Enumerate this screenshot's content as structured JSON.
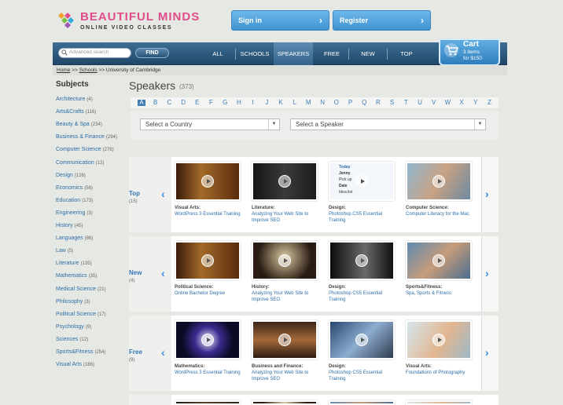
{
  "header": {
    "logo_title": "BEAUTIFUL MINDS",
    "logo_subtitle": "ONLINE VIDEO CLASSES",
    "signin_label": "Sign in",
    "register_label": "Register"
  },
  "search": {
    "placeholder": "Advanced search",
    "find_label": "FIND"
  },
  "nav": {
    "items": [
      "ALL",
      "SCHOOLS",
      "SPEAKERS",
      "FREE",
      "NEW",
      "TOP"
    ],
    "active": "SPEAKERS"
  },
  "cart": {
    "title": "Cart",
    "items": "3 items",
    "total": "for $150"
  },
  "breadcrumb": {
    "home": "Home",
    "sep1": ">>",
    "schools": "Schools",
    "sep2": ">>",
    "current": "University of Cambridge"
  },
  "sidebar": {
    "title": "Subjects",
    "items": [
      {
        "label": "Architecture",
        "count": "(4)"
      },
      {
        "label": "Arts&Crafts",
        "count": "(116)"
      },
      {
        "label": "Beauty & Spa",
        "count": "(234)"
      },
      {
        "label": "Business & Finance",
        "count": "(294)"
      },
      {
        "label": "Computer Science",
        "count": "(276)"
      },
      {
        "label": "Communication",
        "count": "(12)"
      },
      {
        "label": "Design",
        "count": "(126)"
      },
      {
        "label": "Economics",
        "count": "(56)"
      },
      {
        "label": "Education",
        "count": "(173)"
      },
      {
        "label": "Engineering",
        "count": "(3)"
      },
      {
        "label": "History",
        "count": "(45)"
      },
      {
        "label": "Languages",
        "count": "(86)"
      },
      {
        "label": "Law",
        "count": "(5)"
      },
      {
        "label": "Literature",
        "count": "(135)"
      },
      {
        "label": "Mathematics",
        "count": "(35)"
      },
      {
        "label": "Medical Science",
        "count": "(21)"
      },
      {
        "label": "Philosophy",
        "count": "(3)"
      },
      {
        "label": "Political Science",
        "count": "(17)"
      },
      {
        "label": "Psychology",
        "count": "(9)"
      },
      {
        "label": "Sciences",
        "count": "(12)"
      },
      {
        "label": "Sports&Fitness",
        "count": "(254)"
      },
      {
        "label": "Visual Arts",
        "count": "(186)"
      }
    ]
  },
  "main": {
    "title": "Speakers",
    "count": "(373)",
    "letters": [
      "A",
      "B",
      "C",
      "D",
      "E",
      "F",
      "G",
      "H",
      "I",
      "J",
      "K",
      "L",
      "M",
      "N",
      "O",
      "P",
      "Q",
      "R",
      "S",
      "T",
      "U",
      "V",
      "W",
      "X",
      "Y",
      "Z"
    ],
    "active_letter": "A",
    "country_select": "Select a Country",
    "speaker_select": "Select a Speaker",
    "rows": [
      {
        "label": "Top",
        "count": "(15)",
        "videos": [
          {
            "category": "Visual Arts:",
            "title": "WordPress 3 Essential Training"
          },
          {
            "category": "Literature:",
            "title": "Analyzing Your Web Site to Improve SEO"
          },
          {
            "category": "Design:",
            "title": "Photoshop CS5 Essential Training"
          },
          {
            "category": "Computer Science:",
            "title": "Computer Literacy for the Mac"
          }
        ]
      },
      {
        "label": "New",
        "count": "(4)",
        "videos": [
          {
            "category": "Political Science:",
            "title": "Online Bachelor Degree"
          },
          {
            "category": "History:",
            "title": "Analyzing Your Web Site to Improve SEO"
          },
          {
            "category": "Design:",
            "title": "Photoshop CS5 Essential Training"
          },
          {
            "category": "Sports&Fitness:",
            "title": "Spa, Sports & Fitness"
          }
        ]
      },
      {
        "label": "Free",
        "count": "(9)",
        "videos": [
          {
            "category": "Mathematics:",
            "title": "WordPress 3 Essential Training"
          },
          {
            "category": "Business and Finance:",
            "title": "Analyzing Your Web Site to Improve SEO"
          },
          {
            "category": "Design:",
            "title": "Photoshop CS5 Essential Training"
          },
          {
            "category": "Visual Arts:",
            "title": "Foundations of Photography"
          }
        ]
      }
    ],
    "app_preview": {
      "today": "Today",
      "line1": "Jenny",
      "line1b": "est",
      "line2": "Pick up",
      "line2b": "our way hom",
      "line3": "Dale",
      "line4": "Idea list"
    }
  },
  "colors": {
    "brand_pink": "#e14d8a",
    "accent_blue": "#3b7cb5",
    "nav_dark": "#20476a"
  }
}
